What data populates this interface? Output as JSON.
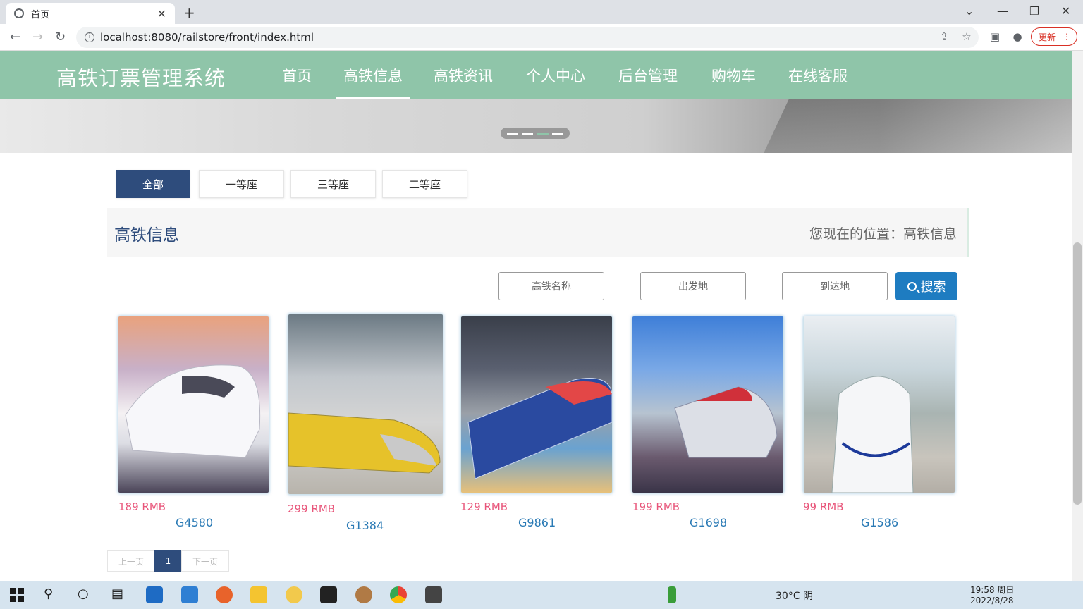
{
  "browser": {
    "tab_title": "首页",
    "url": "localhost:8080/railstore/front/index.html",
    "update_label": "更新"
  },
  "site": {
    "logo": "高铁订票管理系统",
    "nav": [
      "首页",
      "高铁信息",
      "高铁资讯",
      "个人中心",
      "后台管理",
      "购物车",
      "在线客服"
    ],
    "active_nav_index": 1
  },
  "categories": [
    "全部",
    "一等座",
    "三等座",
    "二等座"
  ],
  "section": {
    "title": "高铁信息",
    "location_prefix": "您现在的位置：",
    "location_value": "高铁信息"
  },
  "search": {
    "name_placeholder": "高铁名称",
    "from_placeholder": "出发地",
    "to_placeholder": "到达地",
    "button_label": "搜索"
  },
  "trains": [
    {
      "price": "189 RMB",
      "name": "G4580"
    },
    {
      "price": "299 RMB",
      "name": "G1384"
    },
    {
      "price": "129 RMB",
      "name": "G9861"
    },
    {
      "price": "199 RMB",
      "name": "G1698"
    },
    {
      "price": "99 RMB",
      "name": "G1586"
    }
  ],
  "pagination": {
    "prev": "上一页",
    "current": "1",
    "next": "下一页"
  },
  "taskbar": {
    "weather": "30°C 阴",
    "time": "19:58 周日",
    "date": "2022/8/28"
  }
}
